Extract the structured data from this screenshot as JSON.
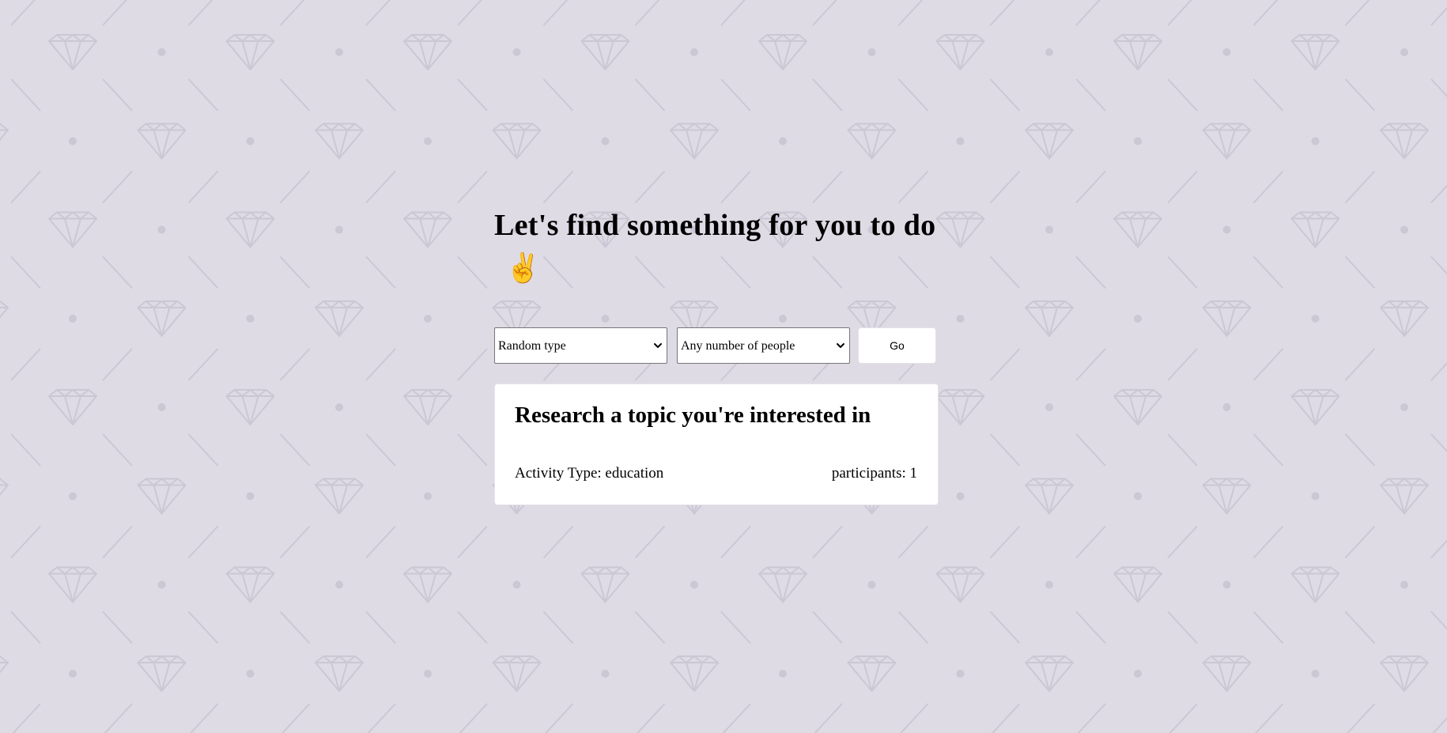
{
  "header": {
    "title": "Let's find something for you to do",
    "emoji": "✌️"
  },
  "filters": {
    "type_select": {
      "selected": "Random type",
      "options": [
        "Random type"
      ]
    },
    "participants_select": {
      "selected": "Any number of people",
      "options": [
        "Any number of people"
      ]
    },
    "go_label": "Go"
  },
  "activity": {
    "title": "Research a topic you're interested in",
    "type_text": "Activity Type: education",
    "participants_text": "participants: 1"
  },
  "colors": {
    "background": "#dedbe5",
    "pattern": "#cbc7d3",
    "card": "#ffffff"
  },
  "icons": {
    "background_motif": "diamond-icon",
    "select_arrow": "chevron-down-icon"
  }
}
